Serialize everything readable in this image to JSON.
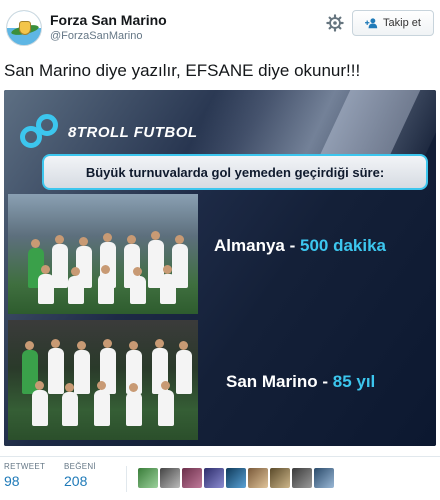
{
  "account": {
    "name": "Forza San Marino",
    "handle": "@ForzaSanMarino"
  },
  "actions": {
    "follow_label": "Takip et"
  },
  "tweet": {
    "text": "San Marino diye yazılır, EFSANE diye okunur!!!"
  },
  "media": {
    "logo_text": "8TROLL FUTBOL",
    "banner": "Büyük turnuvalarda gol yemeden geçirdiği süre:",
    "rows": [
      {
        "team": "Almanya - ",
        "value": "500 dakika"
      },
      {
        "team": "San Marino - ",
        "value": "85 yıl"
      }
    ]
  },
  "stats": {
    "retweet_label": "RETWEET",
    "retweet_count": "98",
    "likes_label": "BEĞENİ",
    "likes_count": "208"
  },
  "colors": {
    "accent": "#3cc6ee",
    "link": "#1f7ab8"
  }
}
